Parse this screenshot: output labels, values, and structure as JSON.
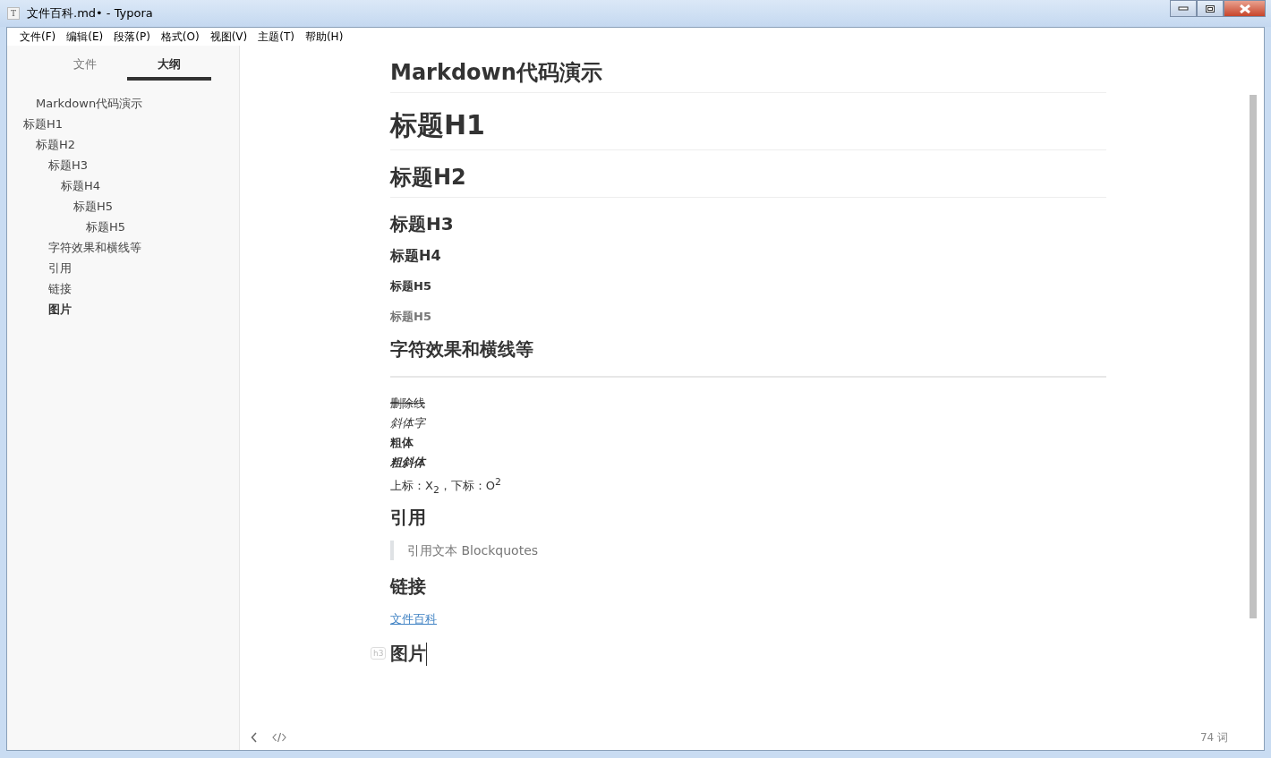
{
  "window": {
    "icon_text": "T",
    "title": "文件百科.md• - Typora"
  },
  "menu": [
    "文件(F)",
    "编辑(E)",
    "段落(P)",
    "格式(O)",
    "视图(V)",
    "主题(T)",
    "帮助(H)"
  ],
  "sidebar": {
    "tabs": [
      {
        "label": "文件",
        "selected": false
      },
      {
        "label": "大纲",
        "selected": true
      }
    ],
    "outline": [
      {
        "label": "Markdown代码演示",
        "kind": "offset",
        "selected": false
      },
      {
        "label": "标题H1",
        "kind": "plain",
        "selected": false,
        "children": [
          {
            "label": "标题H2",
            "selected": false,
            "children": [
              {
                "label": "标题H3",
                "selected": false,
                "children": [
                  {
                    "label": "标题H4",
                    "selected": false,
                    "children": [
                      {
                        "label": "标题H5",
                        "selected": false,
                        "children": [
                          {
                            "label": "标题H5",
                            "selected": false
                          }
                        ]
                      }
                    ]
                  }
                ]
              },
              {
                "label": "字符效果和横线等",
                "selected": false
              },
              {
                "label": "引用",
                "selected": false
              },
              {
                "label": "链接",
                "selected": false
              },
              {
                "label": "图片",
                "selected": true
              }
            ]
          }
        ]
      }
    ]
  },
  "document": [
    {
      "kind": "h2",
      "text": "Markdown代码演示"
    },
    {
      "kind": "h1",
      "text": "标题H1"
    },
    {
      "kind": "h2",
      "text": "标题H2"
    },
    {
      "kind": "h3",
      "text": "标题H3"
    },
    {
      "kind": "h4",
      "text": "标题H4"
    },
    {
      "kind": "h5",
      "text": "标题H5"
    },
    {
      "kind": "h6",
      "text": "标题H5"
    },
    {
      "kind": "h3",
      "text": "字符效果和横线等"
    },
    {
      "kind": "rule"
    },
    {
      "kind": "strike",
      "text": "删除线"
    },
    {
      "kind": "italic",
      "text": "斜体字"
    },
    {
      "kind": "bold",
      "text": "粗体"
    },
    {
      "kind": "bolditalic",
      "text": "粗斜体"
    },
    {
      "kind": "para",
      "text": "上标：X$_{2}$，下标：O$^{2}$"
    },
    {
      "kind": "h3",
      "text": "引用"
    },
    {
      "kind": "quote",
      "text": "引用文本 Blockquotes"
    },
    {
      "kind": "h3",
      "text": "链接"
    },
    {
      "kind": "link",
      "text": "文件百科"
    },
    {
      "kind": "h3",
      "text": "图片",
      "marker": "h3",
      "cursor": true
    }
  ],
  "status_bar": {
    "word_count": "74 词"
  }
}
